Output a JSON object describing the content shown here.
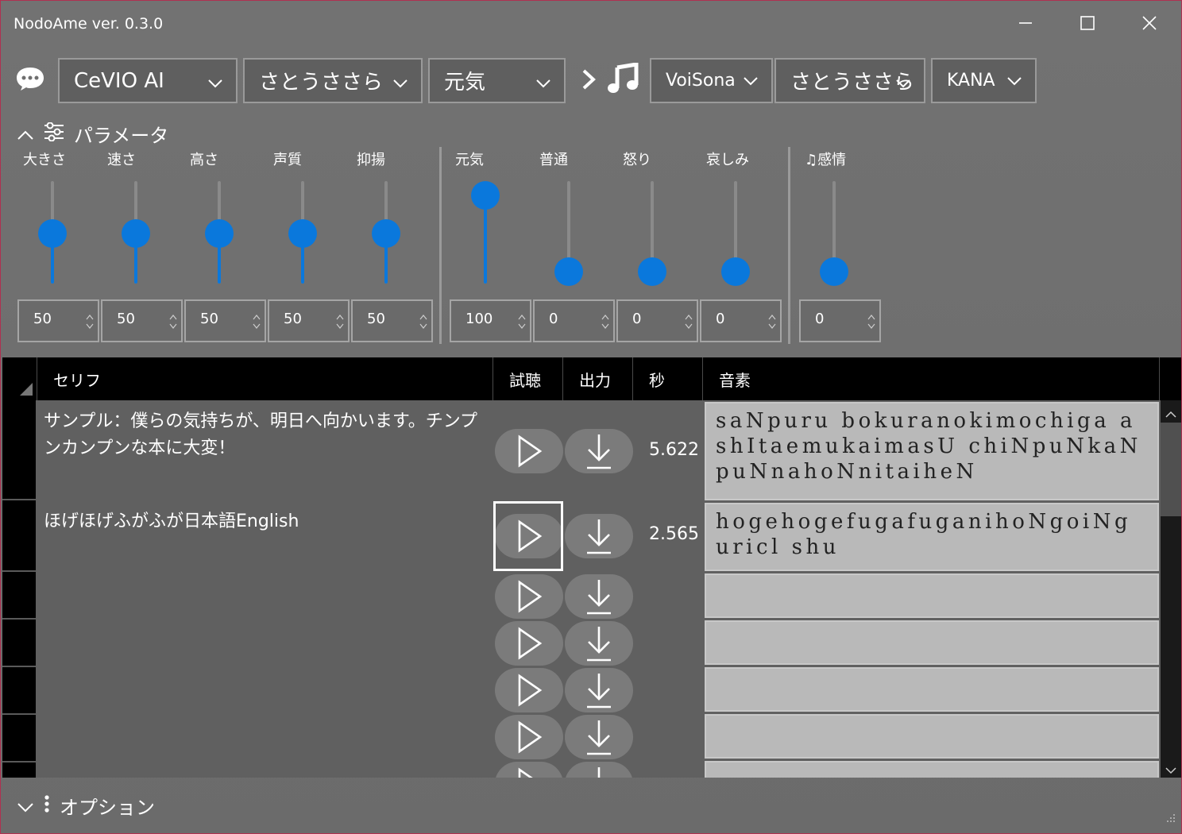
{
  "window": {
    "title": "NodoAme ver. 0.3.0"
  },
  "toolbar": {
    "engine": "CeVIO AI",
    "voice": "さとうささら",
    "style": "元気",
    "target_engine": "VoiSona",
    "target_voice": "さとうささら",
    "mode": "KANA"
  },
  "params": {
    "header": "パラメータ",
    "labels": [
      "大きさ",
      "速さ",
      "高さ",
      "声質",
      "抑揚"
    ],
    "values": [
      "50",
      "50",
      "50",
      "50",
      "50"
    ],
    "levels": [
      0.5,
      0.5,
      0.5,
      0.5,
      0.5
    ],
    "emotion_labels": [
      "元気",
      "普通",
      "怒り",
      "哀しみ"
    ],
    "emotion_values": [
      "100",
      "0",
      "0",
      "0"
    ],
    "emotion_levels": [
      1.0,
      0,
      0,
      0
    ],
    "song_label": "♫感情",
    "song_value": "0",
    "song_level": 0,
    "accent": "#0a78dc"
  },
  "grid": {
    "headers": {
      "serifu": "セリフ",
      "listen": "試聴",
      "output": "出力",
      "sec": "秒",
      "phoneme": "音素"
    },
    "rows": [
      {
        "serifu": "サンプル：僕らの気持ちが、明日へ向かいます。チンプンカンプンな本に大変！",
        "seconds": "5.622",
        "phoneme": "saNpuru bokuranokimochiga ashItaemukaimasU chiNpuNkaNpuNnahoNnitaiheN"
      },
      {
        "serifu": "ほげほげふがふが日本語English",
        "seconds": "2.565",
        "phoneme": "hogehogefugafuganihoNgoiNguricl shu"
      }
    ]
  },
  "options": {
    "label": "オプション"
  }
}
